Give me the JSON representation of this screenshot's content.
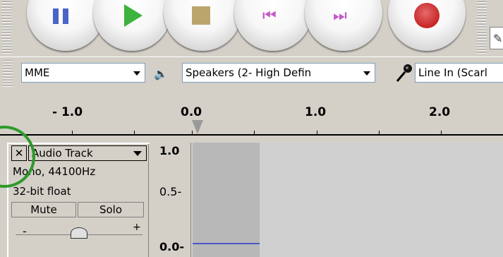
{
  "transport": {
    "buttons": [
      {
        "name": "pause",
        "icon": "pause-icon",
        "color": "#4a65c7"
      },
      {
        "name": "play",
        "icon": "play-icon",
        "color": "#3db33d"
      },
      {
        "name": "stop",
        "icon": "stop-icon",
        "color": "#bba56c"
      },
      {
        "name": "skip-start",
        "icon": "skip-to-start-icon",
        "glyph": "⏮",
        "color": "#c45ac8"
      },
      {
        "name": "skip-end",
        "icon": "skip-to-end-icon",
        "glyph": "⏭",
        "color": "#c45ac8"
      },
      {
        "name": "record",
        "icon": "record-icon",
        "color": "#c72525"
      }
    ]
  },
  "devices": {
    "host": "MME",
    "speaker_icon": "🔈",
    "output": "Speakers (2- High Defin",
    "input": "Line In (Scarl"
  },
  "ruler": {
    "labels": [
      "- 1.0",
      "0.0",
      "1.0",
      "2.0"
    ]
  },
  "track": {
    "close_label": "✕",
    "name": "Audio Track",
    "format": "Mono, 44100Hz",
    "bit_depth": "32-bit float",
    "mute_label": "Mute",
    "solo_label": "Solo",
    "gain_minus": "-",
    "gain_plus": "+"
  },
  "vertical_ruler": {
    "labels": [
      "1.0",
      "0.5-",
      "0.0-"
    ]
  },
  "colors": {
    "highlight": "#2e9a2a",
    "waveform": "#4a58c8"
  }
}
